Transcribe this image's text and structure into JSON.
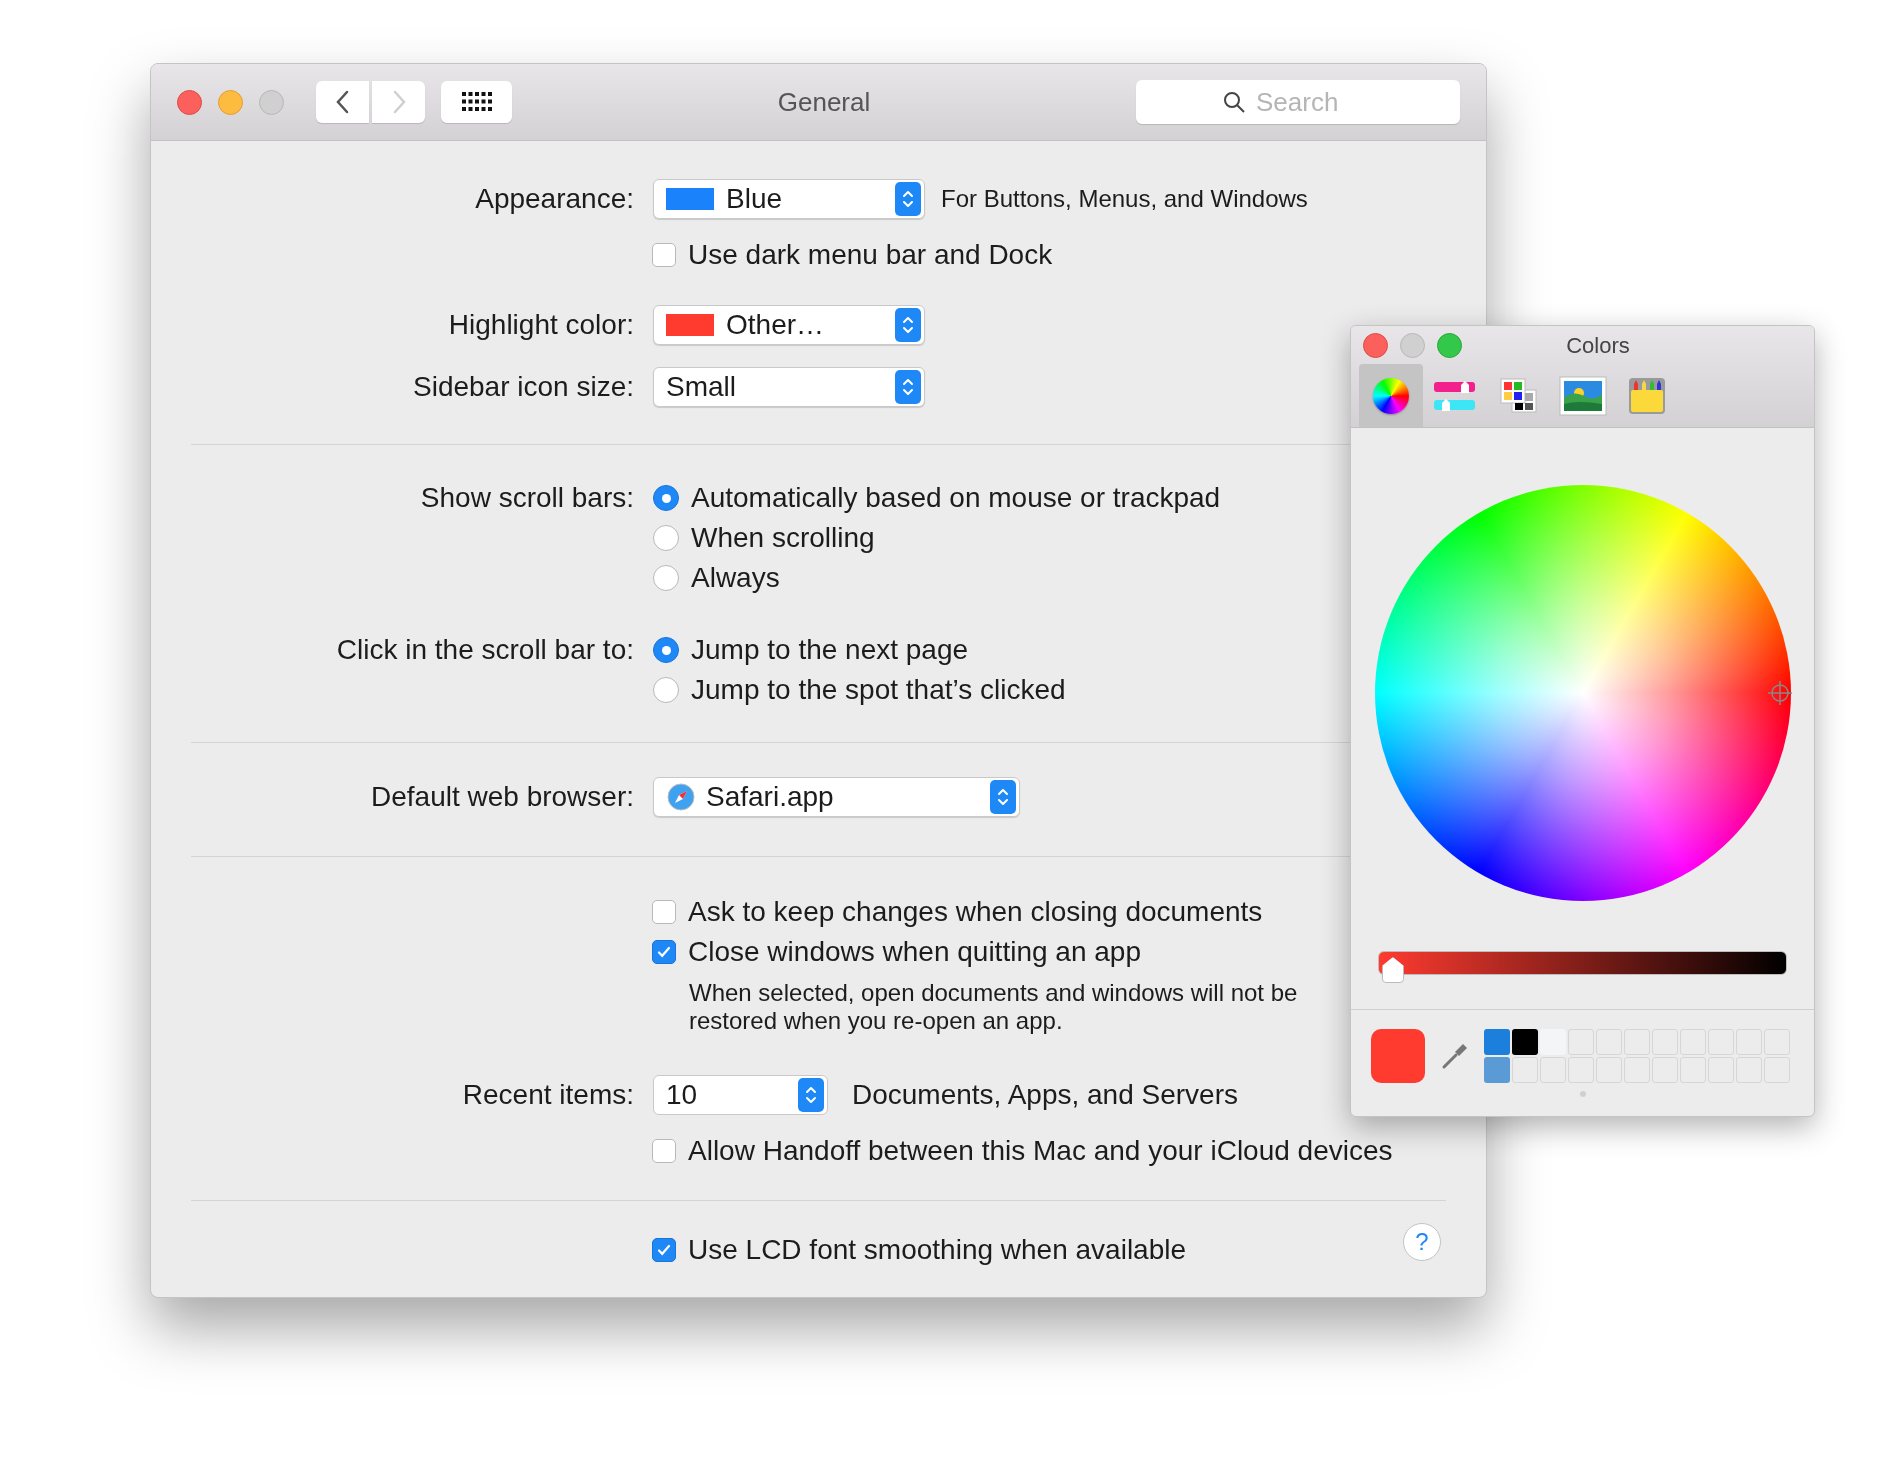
{
  "window": {
    "title": "General",
    "back": {
      "disabled": false
    },
    "forward": {
      "disabled": true
    },
    "zoom_disabled": true,
    "search": {
      "placeholder": "Search"
    }
  },
  "appearance": {
    "label": "Appearance:",
    "value": "Blue",
    "color": "#1a82fb",
    "note": "For Buttons, Menus, and Windows"
  },
  "dark_menu": {
    "label": "Use dark menu bar and Dock",
    "checked": false
  },
  "highlight": {
    "label": "Highlight color:",
    "value": "Other…",
    "color": "#ff3b30"
  },
  "sidebar_size": {
    "label": "Sidebar icon size:",
    "value": "Small"
  },
  "scroll_bars": {
    "label": "Show scroll bars:",
    "options": [
      {
        "label": "Automatically based on mouse or trackpad",
        "selected": true
      },
      {
        "label": "When scrolling",
        "selected": false
      },
      {
        "label": "Always",
        "selected": false
      }
    ]
  },
  "click_scroll": {
    "label": "Click in the scroll bar to:",
    "options": [
      {
        "label": "Jump to the next page",
        "selected": true
      },
      {
        "label": "Jump to the spot that’s clicked",
        "selected": false
      }
    ]
  },
  "browser": {
    "label": "Default web browser:",
    "value": "Safari.app"
  },
  "documents": [
    {
      "label": "Ask to keep changes when closing documents",
      "checked": false
    },
    {
      "label": "Close windows when quitting an app",
      "checked": true
    }
  ],
  "documents_note": "When selected, open documents and windows will not be restored when you re-open an app.",
  "recent": {
    "label": "Recent items:",
    "value": "10",
    "note": "Documents, Apps, and Servers"
  },
  "handoff": {
    "label": "Allow Handoff between this Mac and your iCloud devices",
    "checked": false
  },
  "lcd": {
    "label": "Use LCD font smoothing when available",
    "checked": true
  },
  "help": "?",
  "colors_panel": {
    "title": "Colors",
    "minimize_disabled": true,
    "tabs": [
      {
        "kind": "wheel",
        "selected": true
      },
      {
        "kind": "sliders",
        "selected": false
      },
      {
        "kind": "palettes",
        "selected": false
      },
      {
        "kind": "image",
        "selected": false
      },
      {
        "kind": "pencils",
        "selected": false
      }
    ],
    "brightness": {
      "level": 0.02
    },
    "current": {
      "color": "#ff3b30"
    },
    "swatches": [
      {
        "kind": "color",
        "color": "#1c7fdb"
      },
      {
        "kind": "color",
        "color": "#000000"
      },
      {
        "kind": "color",
        "color": "#f4f5f7"
      },
      {
        "kind": "empty"
      },
      {
        "kind": "empty"
      },
      {
        "kind": "empty"
      },
      {
        "kind": "empty"
      },
      {
        "kind": "empty"
      },
      {
        "kind": "empty"
      },
      {
        "kind": "empty"
      },
      {
        "kind": "empty"
      },
      {
        "kind": "color",
        "color": "#5b9bd5"
      },
      {
        "kind": "empty"
      },
      {
        "kind": "empty"
      },
      {
        "kind": "empty"
      },
      {
        "kind": "empty"
      },
      {
        "kind": "empty"
      },
      {
        "kind": "empty"
      },
      {
        "kind": "empty"
      },
      {
        "kind": "empty"
      },
      {
        "kind": "empty"
      },
      {
        "kind": "empty"
      }
    ]
  }
}
